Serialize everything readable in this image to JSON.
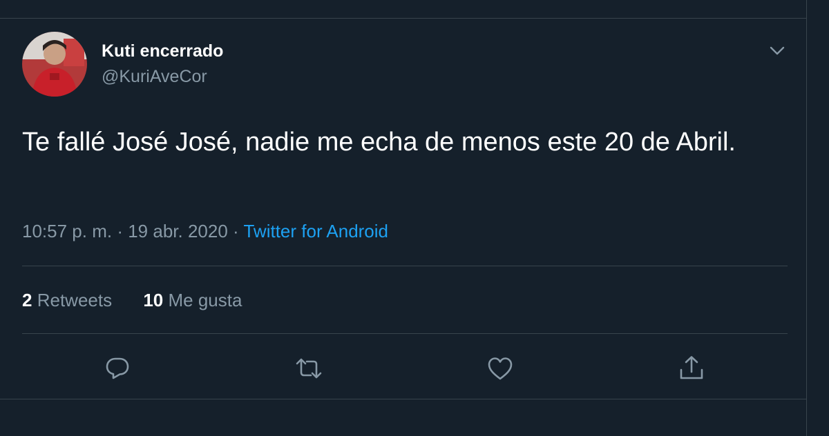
{
  "author": {
    "display_name": "Kuti encerrado",
    "handle": "@KuriAveCor"
  },
  "tweet": {
    "text": "Te fallé José José, nadie me echa de menos este 20 de Abril.",
    "time": "10:57 p. m.",
    "separator": "·",
    "date": "19 abr. 2020",
    "source": "Twitter for Android"
  },
  "stats": {
    "retweets_count": "2",
    "retweets_label": "Retweets",
    "likes_count": "10",
    "likes_label": "Me gusta"
  },
  "actions": [
    "reply-icon",
    "retweet-icon",
    "like-icon",
    "share-icon"
  ],
  "colors": {
    "background": "#15202b",
    "border": "#38444d",
    "secondary_text": "#8899a6",
    "accent": "#1da1f2"
  }
}
